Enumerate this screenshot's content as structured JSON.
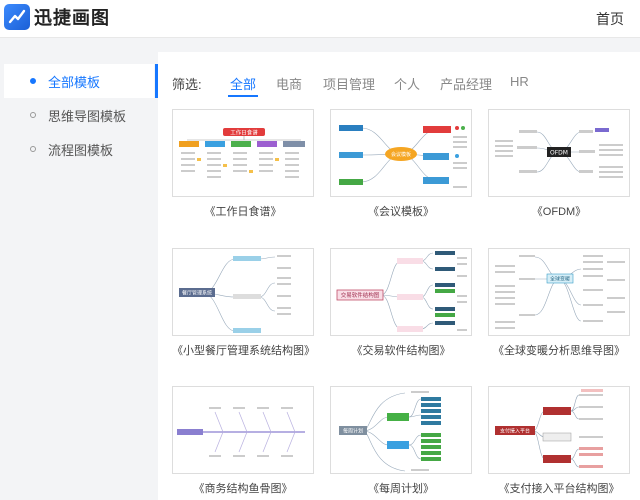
{
  "header": {
    "brand": "迅捷画图",
    "home_link": "首页"
  },
  "sidebar": {
    "items": [
      {
        "label": "全部模板",
        "active": true
      },
      {
        "label": "思维导图模板",
        "active": false
      },
      {
        "label": "流程图模板",
        "active": false
      }
    ]
  },
  "filter": {
    "label": "筛选:",
    "tabs": [
      {
        "label": "全部",
        "active": true
      },
      {
        "label": "电商",
        "active": false
      },
      {
        "label": "项目管理",
        "active": false
      },
      {
        "label": "个人",
        "active": false
      },
      {
        "label": "产品经理",
        "active": false
      },
      {
        "label": "HR",
        "active": false
      }
    ]
  },
  "templates": [
    {
      "title": "《工作日食谱》",
      "center": "工作日食谱"
    },
    {
      "title": "《会议模板》",
      "center": "会议模板"
    },
    {
      "title": "《OFDM》",
      "center": "OFDM"
    },
    {
      "title": "《小型餐厅管理系统结构图》",
      "center": "餐厅管理系统"
    },
    {
      "title": "《交易软件结构图》",
      "center": "交易软件结构图"
    },
    {
      "title": "《全球变暖分析思维导图》",
      "center": "全球变暖"
    },
    {
      "title": "《商务结构鱼骨图》",
      "center": ""
    },
    {
      "title": "《每周计划》",
      "center": "每周计划"
    },
    {
      "title": "《支付接入平台结构图》",
      "center": "支付接入平台"
    }
  ],
  "colors": {
    "accent": "#1677ff"
  }
}
